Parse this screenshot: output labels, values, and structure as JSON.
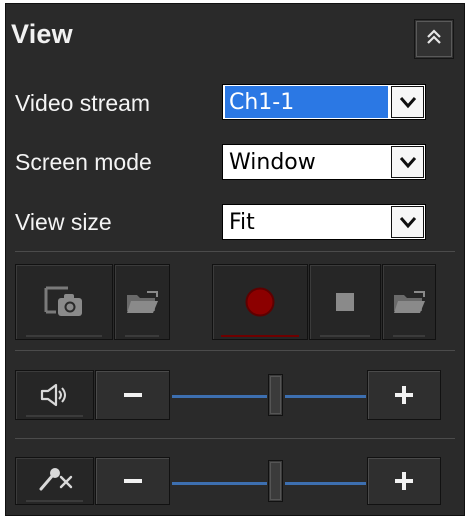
{
  "panel": {
    "title": "View"
  },
  "rows": {
    "video_stream": {
      "label": "Video stream",
      "value": "Ch1-1"
    },
    "screen_mode": {
      "label": "Screen mode",
      "value": "Window"
    },
    "view_size": {
      "label": "View size",
      "value": "Fit"
    }
  },
  "toolbar": {
    "snapshot_icon": "camera-frame-icon",
    "open_folder_icon": "folder-open-icon",
    "record_icon": "record-icon",
    "stop_icon": "stop-icon",
    "open_record_folder_icon": "folder-open-icon"
  },
  "audio": {
    "speaker_icon": "speaker-icon",
    "mic_icon": "microphone-off-icon",
    "decrease_icon": "minus-icon",
    "increase_icon": "plus-icon"
  },
  "colors": {
    "panel_bg": "#2a2a2a",
    "slider_line": "#3d6fb0",
    "record_red": "#8c0000",
    "selected_blue": "#2b78e4"
  }
}
